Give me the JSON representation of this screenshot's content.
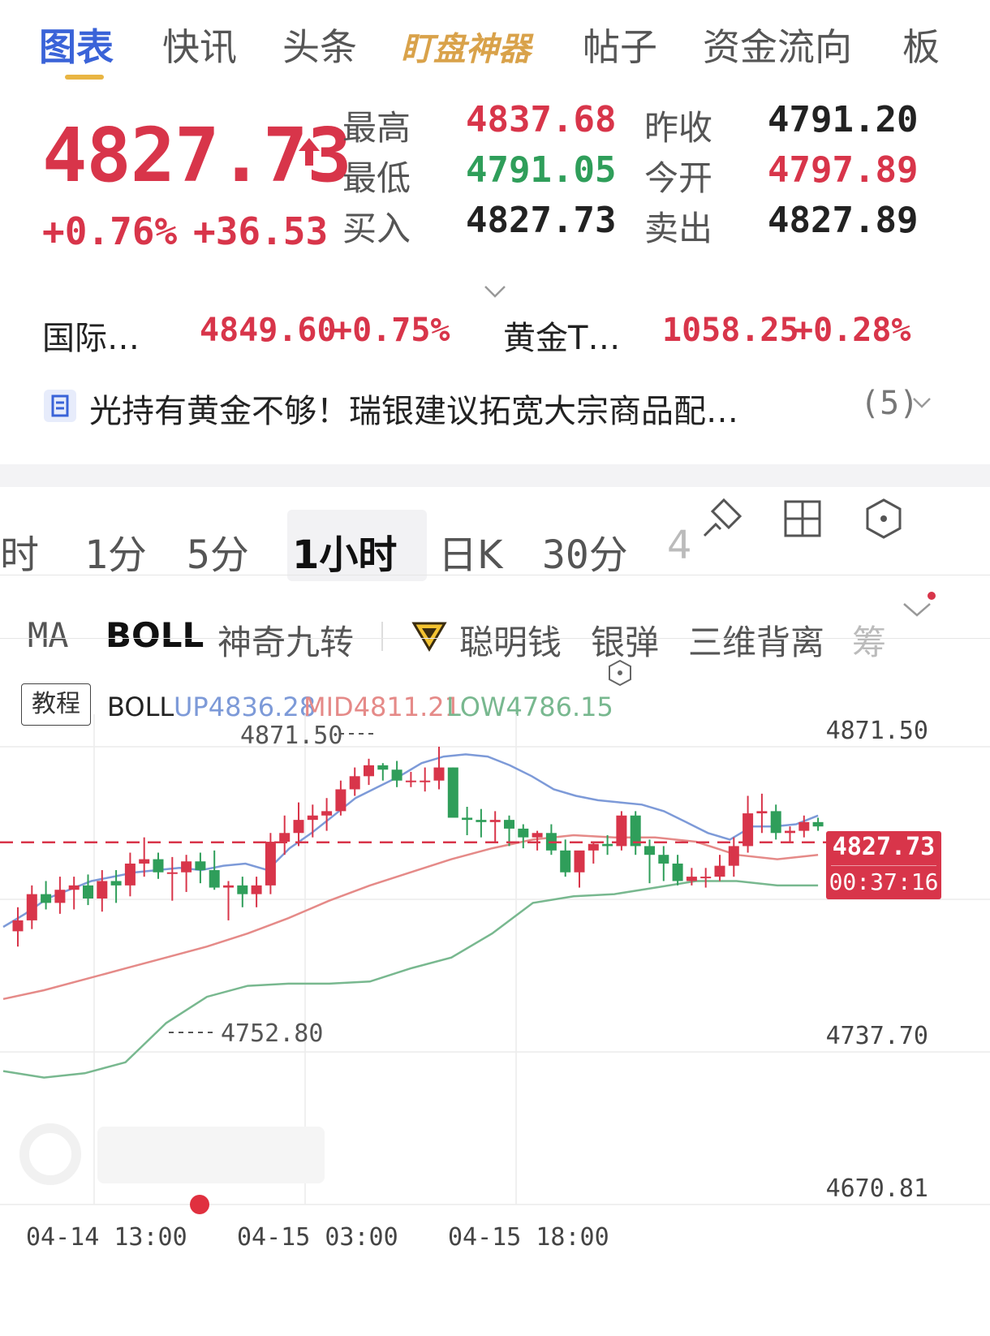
{
  "top_tabs": [
    {
      "label": "图表",
      "active": true
    },
    {
      "label": "快讯"
    },
    {
      "label": "头条"
    },
    {
      "label": "盯盘神器",
      "special": true
    },
    {
      "label": "帖子"
    },
    {
      "label": "资金流向"
    },
    {
      "label": "板"
    }
  ],
  "quote": {
    "price": "4827.73",
    "change_pct": "+0.76%",
    "change_abs": "+36.53",
    "rows": [
      {
        "l1": "最高",
        "v1": "4837.68",
        "c1": "red",
        "l2": "昨收",
        "v2": "4791.20",
        "c2": "dark"
      },
      {
        "l1": "最低",
        "v1": "4791.05",
        "c1": "green",
        "l2": "今开",
        "v2": "4797.89",
        "c2": "red"
      },
      {
        "l1": "买入",
        "v1": "4827.73",
        "c1": "dark",
        "l2": "卖出",
        "v2": "4827.89",
        "c2": "dark"
      }
    ]
  },
  "related": [
    {
      "name": "国际…",
      "price": "4849.60",
      "pct": "+0.75%"
    },
    {
      "name": "黄金T…",
      "price": "1058.25",
      "pct": "+0.28%"
    }
  ],
  "news": {
    "text": "光持有黄金不够！瑞银建议拓宽大宗商品配…",
    "count": "(5)"
  },
  "interval_tabs": [
    "时",
    "1分",
    "5分",
    "1小时",
    "日K",
    "30分",
    "4"
  ],
  "interval_active": "1小时",
  "indicator_tabs": [
    "MA",
    "BOLL",
    "神奇九转",
    "聪明钱",
    "银弹",
    "三维背离",
    "筹"
  ],
  "indicator_active": "BOLL",
  "boll_legend": {
    "tutorial": "教程",
    "name": "BOLL",
    "up": "UP4836.28",
    "mid": "MID4811.21",
    "low": "LOW4786.15"
  },
  "colors": {
    "up": "#d8354a",
    "down": "#2f9e5a",
    "boll_up": "#7d9ad8",
    "boll_mid": "#e58a88",
    "boll_low": "#78b88f",
    "accent": "#3a63d8"
  },
  "chart_data": {
    "type": "candlestick",
    "y_axis_labels": [
      "4871.50",
      "4737.70",
      "4670.81"
    ],
    "ylim": [
      4670.81,
      4871.5
    ],
    "x_tick_labels": [
      "04-14 13:00",
      "04-15 03:00",
      "04-15 18:00"
    ],
    "max_marker": "4871.50",
    "min_marker": "4752.80",
    "current_price": "4827.73",
    "countdown": "00:37:16",
    "candles": [
      [
        4787,
        4798,
        4780,
        4792
      ],
      [
        4792,
        4808,
        4788,
        4804
      ],
      [
        4804,
        4810,
        4797,
        4800
      ],
      [
        4800,
        4812,
        4795,
        4806
      ],
      [
        4806,
        4812,
        4797,
        4808
      ],
      [
        4808,
        4813,
        4799,
        4802
      ],
      [
        4802,
        4815,
        4796,
        4810
      ],
      [
        4810,
        4815,
        4800,
        4808
      ],
      [
        4808,
        4823,
        4803,
        4818
      ],
      [
        4818,
        4830,
        4812,
        4820
      ],
      [
        4820,
        4823,
        4811,
        4814
      ],
      [
        4814,
        4821,
        4801,
        4814
      ],
      [
        4814,
        4822,
        4805,
        4819
      ],
      [
        4819,
        4823,
        4809,
        4815
      ],
      [
        4815,
        4824,
        4806,
        4807
      ],
      [
        4807,
        4810,
        4792,
        4808
      ],
      [
        4808,
        4812,
        4798,
        4804
      ],
      [
        4804,
        4812,
        4798,
        4808
      ],
      [
        4808,
        4832,
        4804,
        4828
      ],
      [
        4828,
        4840,
        4822,
        4832
      ],
      [
        4832,
        4846,
        4826,
        4838
      ],
      [
        4838,
        4845,
        4830,
        4840
      ],
      [
        4840,
        4848,
        4833,
        4842
      ],
      [
        4842,
        4856,
        4840,
        4852
      ],
      [
        4852,
        4862,
        4849,
        4858
      ],
      [
        4858,
        4866,
        4854,
        4863
      ],
      [
        4863,
        4864,
        4856,
        4861
      ],
      [
        4861,
        4865,
        4853,
        4856
      ],
      [
        4856,
        4860,
        4853,
        4856
      ],
      [
        4856,
        4862,
        4851,
        4856
      ],
      [
        4856,
        4871.5,
        4852,
        4862
      ],
      [
        4862,
        4862,
        4840,
        4839
      ],
      [
        4839,
        4844,
        4831,
        4838
      ],
      [
        4838,
        4843,
        4830,
        4837
      ],
      [
        4837,
        4842,
        4828,
        4838
      ],
      [
        4838,
        4840,
        4826,
        4834
      ],
      [
        4834,
        4836,
        4825,
        4830
      ],
      [
        4830,
        4833,
        4824,
        4832
      ],
      [
        4832,
        4836,
        4822,
        4824
      ],
      [
        4824,
        4829,
        4812,
        4814
      ],
      [
        4814,
        4820,
        4807,
        4824
      ],
      [
        4824,
        4828,
        4818,
        4827
      ],
      [
        4827,
        4831,
        4822,
        4826
      ],
      [
        4826,
        4842,
        4824,
        4840
      ],
      [
        4840,
        4842,
        4822,
        4826
      ],
      [
        4826,
        4829,
        4809,
        4822
      ],
      [
        4822,
        4826,
        4810,
        4818
      ],
      [
        4818,
        4822,
        4808,
        4810
      ],
      [
        4810,
        4816,
        4808,
        4812
      ],
      [
        4812,
        4816,
        4807,
        4812
      ],
      [
        4812,
        4822,
        4810,
        4817
      ],
      [
        4817,
        4830,
        4812,
        4826
      ],
      [
        4826,
        4849,
        4823,
        4841
      ],
      [
        4841,
        4850,
        4832,
        4842
      ],
      [
        4842,
        4845,
        4829,
        4832
      ],
      [
        4832,
        4835,
        4828,
        4833
      ],
      [
        4833,
        4840,
        4830,
        4837
      ],
      [
        4837,
        4839,
        4833,
        4835
      ]
    ],
    "boll_up": [
      4789,
      4795,
      4802,
      4806,
      4810,
      4812,
      4814,
      4815,
      4816,
      4815,
      4817,
      4818,
      4815,
      4825,
      4832,
      4840,
      4848,
      4853,
      4858,
      4864,
      4867,
      4868,
      4867,
      4863,
      4858,
      4852,
      4849,
      4847,
      4846,
      4845,
      4842,
      4837,
      4832,
      4829,
      4835,
      4835,
      4836,
      4840
    ],
    "boll_mid": [
      4756,
      4760,
      4765,
      4770,
      4775,
      4780,
      4786,
      4793,
      4801,
      4808,
      4814,
      4820,
      4825,
      4829,
      4831,
      4830,
      4830,
      4828,
      4822,
      4820,
      4822
    ],
    "boll_low": [
      4723,
      4720,
      4722,
      4727,
      4745,
      4757,
      4762,
      4763,
      4763,
      4764,
      4770,
      4775,
      4786,
      4800,
      4803,
      4804,
      4807,
      4810,
      4810,
      4808,
      4808
    ]
  }
}
